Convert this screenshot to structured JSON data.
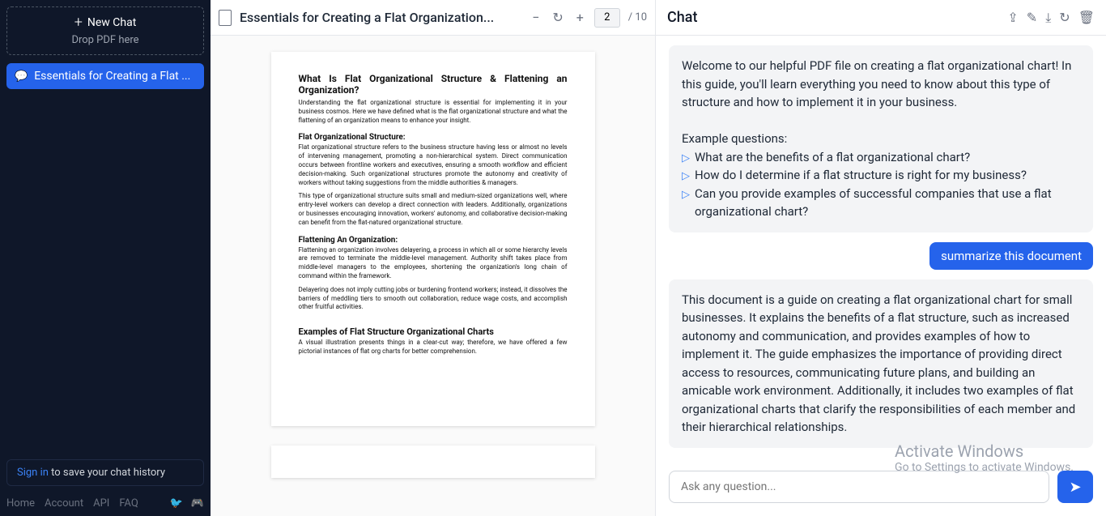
{
  "sidebar": {
    "new_chat_label": "New Chat",
    "drop_pdf_label": "Drop PDF here",
    "active_chat_label": "Essentials for Creating a Flat ...",
    "signin_label": "Sign in",
    "signin_rest": " to save your chat history",
    "links": {
      "home": "Home",
      "account": "Account",
      "api": "API",
      "faq": "FAQ"
    }
  },
  "pdf": {
    "title": "Essentials for Creating a Flat Organization...",
    "current_page": "2",
    "total_pages": "/ 10",
    "page": {
      "h1": "What Is Flat Organizational Structure & Flattening an Organization?",
      "p1": "Understanding the flat organizational structure is essential for implementing it in your business cosmos. Here we have defined what is the flat organizational structure and what the flattening of an organization means to enhance your insight.",
      "h2": "Flat Organizational Structure:",
      "p2": "Flat organizational structure refers to the business structure having less or almost no levels of intervening management, promoting a non-hierarchical system. Direct communication occurs between frontline workers and executives, ensuring a smooth workflow and efficient decision-making. Such organizational structures promote the autonomy and creativity of workers without taking suggestions from the middle authorities & managers.",
      "p3": "This type of organizational structure suits small and medium-sized organizations well, where entry-level workers can develop a direct connection with leaders. Additionally, organizations or businesses encouraging innovation, workers' autonomy, and collaborative decision-making can benefit from the flat-natured organizational structure.",
      "h3": "Flattening An Organization:",
      "p4": "Flattening an organization involves delayering, a process in which all or some hierarchy levels are removed to terminate the middle-level management. Authority shift takes place from middle-level managers to the employees, shortening the organization's long chain of command within the framework.",
      "p5": "Delayering does not imply cutting jobs or burdening frontend workers; instead, it dissolves the barriers of meddling tiers to smooth out collaboration, reduce wage costs, and accomplish other fruitful activities.",
      "h4": "Examples of Flat Structure Organizational Charts",
      "p6": "A visual illustration presents things in a clear-cut way; therefore, we have offered a few pictorial instances of flat org charts for better comprehension."
    }
  },
  "chat": {
    "title": "Chat",
    "welcome_p1": "Welcome to our helpful PDF file on creating a flat organizational chart! In this guide, you'll learn everything you need to know about this type of structure and how to implement it in your business.",
    "example_heading": "Example questions:",
    "q1": "What are the benefits of a flat organizational chart?",
    "q2": "How do I determine if a flat structure is right for my business?",
    "q3": "Can you provide examples of successful companies that use a flat organizational chart?",
    "user_msg": "summarize this document",
    "bot_reply": "This document is a guide on creating a flat organizational chart for small businesses. It explains the benefits of a flat structure, such as increased autonomy and communication, and provides examples of how to implement it. The guide emphasizes the importance of providing direct access to resources, communicating future plans, and building an amicable work environment. Additionally, it includes two examples of flat organizational charts that clarify the responsibilities of each member and their hierarchical relationships.",
    "input_placeholder": "Ask any question..."
  },
  "watermark": {
    "line1": "Activate Windows",
    "line2": "Go to Settings to activate Windows."
  }
}
